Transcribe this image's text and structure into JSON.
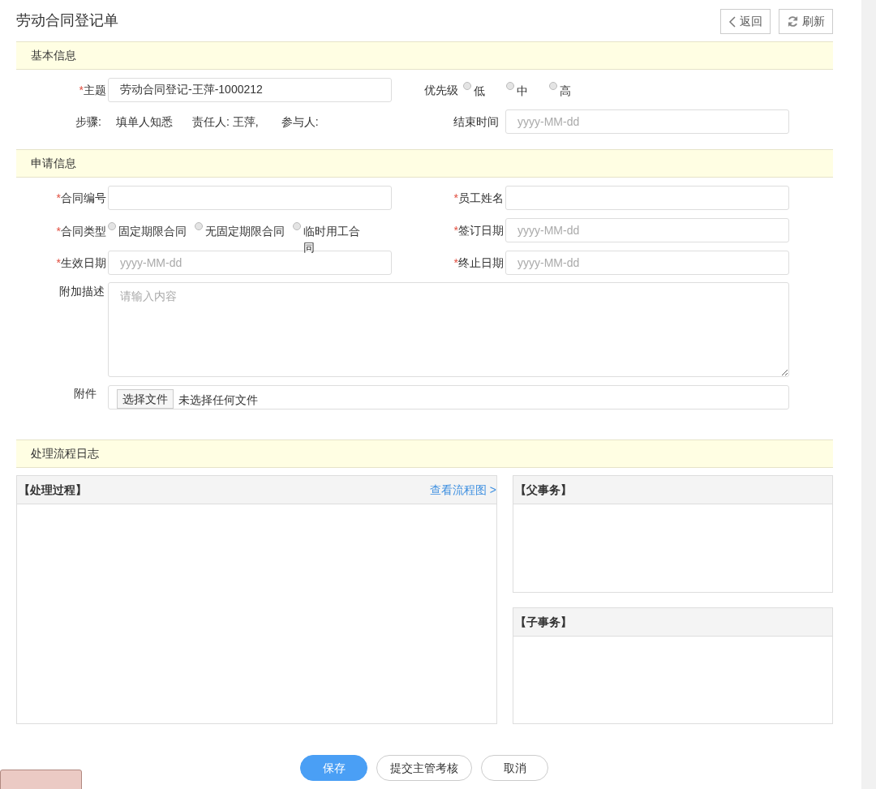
{
  "title": "劳动合同登记单",
  "header_buttons": [
    {
      "kind": "back",
      "label": "返回"
    },
    {
      "kind": "refresh",
      "label": "刷新"
    }
  ],
  "basic_info": {
    "heading": "基本信息",
    "subject": {
      "mark": "*",
      "label": "主题",
      "value": "劳动合同登记-王萍-1000212"
    },
    "priority": {
      "label": "优先级",
      "options": [
        {
          "label": "低",
          "selected": false
        },
        {
          "label": "中",
          "selected": false
        },
        {
          "label": "高",
          "selected": false
        }
      ]
    },
    "steps": {
      "label": "步骤:",
      "value": "填单人知悉"
    },
    "owner": "责任人: 王萍,",
    "participants": "参与人:",
    "end_time": {
      "label": "结束时间",
      "placeholder": "yyyy-MM-dd"
    }
  },
  "application_info": {
    "heading": "申请信息",
    "contract_no": {
      "mark": "*",
      "label": "合同编号"
    },
    "employee_name": {
      "mark": "*",
      "label": "员工姓名"
    },
    "contract_type": {
      "mark": "*",
      "label": "合同类型",
      "options": [
        {
          "label": "固定期限合同",
          "selected": false
        },
        {
          "label": "无固定期限合同",
          "selected": false
        },
        {
          "label": "临时用工合同",
          "selected": false
        }
      ]
    },
    "sign_date": {
      "mark": "*",
      "label": "签订日期",
      "placeholder": "yyyy-MM-dd"
    },
    "effective_date": {
      "mark": "*",
      "label": "生效日期",
      "placeholder": "yyyy-MM-dd"
    },
    "end_date": {
      "mark": "*",
      "label": "终止日期",
      "placeholder": "yyyy-MM-dd"
    },
    "description": {
      "label": "附加描述",
      "placeholder": "请输入内容"
    },
    "attachment": {
      "label": "附件",
      "button": "选择文件",
      "status": "未选择任何文件"
    }
  },
  "process_log": {
    "heading": "处理流程日志",
    "process": {
      "title": "【处理过程】",
      "link": "查看流程图 >"
    },
    "parent": {
      "title": "【父事务】"
    },
    "child": {
      "title": "【子事务】"
    }
  },
  "footer_buttons": [
    {
      "kind": "primary",
      "label": "保存"
    },
    {
      "kind": "default",
      "label": "提交主管考核"
    },
    {
      "kind": "default",
      "label": "取消"
    }
  ]
}
